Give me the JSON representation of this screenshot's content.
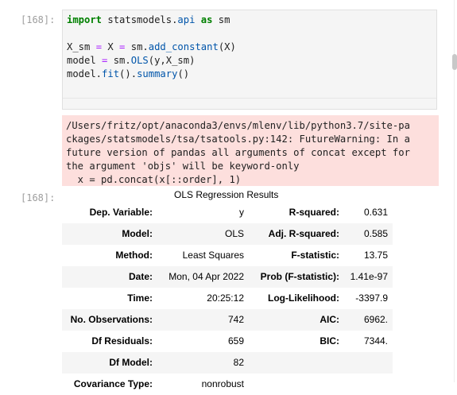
{
  "cells": {
    "input_prompt": "[168]:",
    "output_prompt": "[168]:"
  },
  "code": {
    "line1": {
      "t1": "import",
      "t2": " statsmodels.",
      "t3": "api",
      "t4": " ",
      "t5": "as",
      "t6": " sm"
    },
    "line2": {
      "t1": "X_sm ",
      "t2": "=",
      "t3": " X ",
      "t4": "=",
      "t5": " sm.",
      "t6": "add_constant",
      "t7": "(X)"
    },
    "line3": {
      "t1": "model ",
      "t2": "=",
      "t3": " sm.",
      "t4": "OLS",
      "t5": "(y,X_sm)"
    },
    "line4": {
      "t1": "model.",
      "t2": "fit",
      "t3": "().",
      "t4": "summary",
      "t5": "()"
    }
  },
  "stderr_lines": [
    "/Users/fritz/opt/anaconda3/envs/mlenv/lib/python3.7/site-pa",
    "ckages/statsmodels/tsa/tsatools.py:142: FutureWarning: In a",
    "future version of pandas all arguments of concat except for",
    "the argument 'objs' will be keyword-only",
    "  x = pd.concat(x[::order], 1)"
  ],
  "summary": {
    "caption": "OLS Regression Results",
    "rows": [
      {
        "l1": "Dep. Variable:",
        "v1": "y",
        "l2": "R-squared:",
        "v2": "0.631"
      },
      {
        "l1": "Model:",
        "v1": "OLS",
        "l2": "Adj. R-squared:",
        "v2": "0.585"
      },
      {
        "l1": "Method:",
        "v1": "Least Squares",
        "l2": "F-statistic:",
        "v2": "13.75"
      },
      {
        "l1": "Date:",
        "v1": "Mon, 04 Apr 2022",
        "l2": "Prob (F-statistic):",
        "v2": "1.41e-97"
      },
      {
        "l1": "Time:",
        "v1": "20:25:12",
        "l2": "Log-Likelihood:",
        "v2": "-3397.9"
      },
      {
        "l1": "No. Observations:",
        "v1": "742",
        "l2": "AIC:",
        "v2": "6962."
      },
      {
        "l1": "Df Residuals:",
        "v1": "659",
        "l2": "BIC:",
        "v2": "7344."
      },
      {
        "l1": "Df Model:",
        "v1": "82",
        "l2": "",
        "v2": ""
      },
      {
        "l1": "Covariance Type:",
        "v1": "nonrobust",
        "l2": "",
        "v2": ""
      }
    ]
  }
}
